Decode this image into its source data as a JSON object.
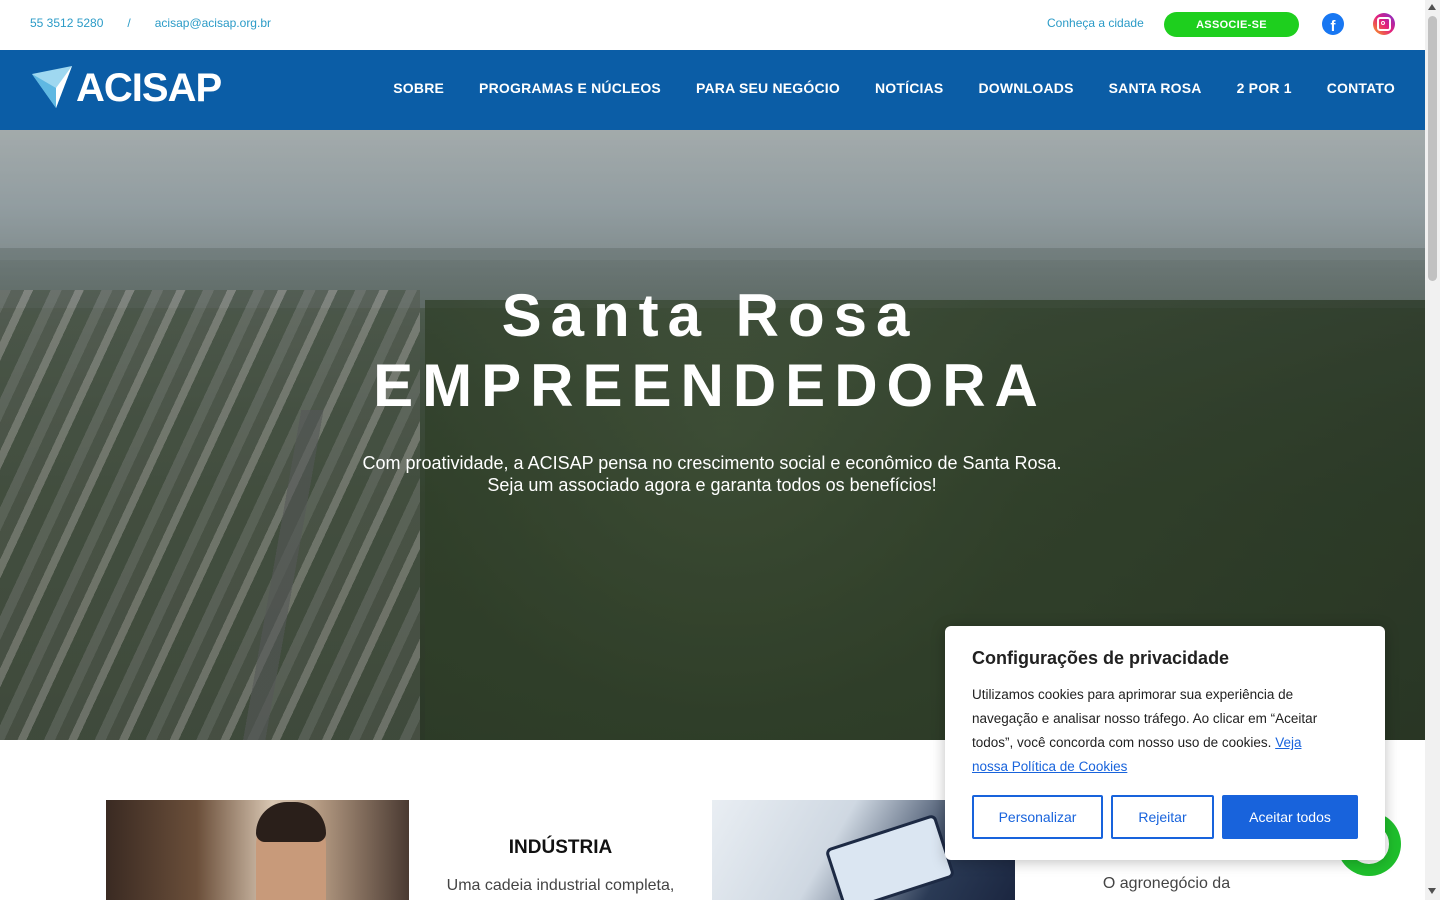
{
  "topbar": {
    "phone": "55 3512 5280",
    "separator": "/",
    "email": "acisap@acisap.org.br",
    "city_link": "Conheça a cidade",
    "associate_button": "ASSOCIE-SE",
    "facebook_glyph": "f"
  },
  "nav": {
    "logo_text": "ACISAP",
    "items": [
      "SOBRE",
      "PROGRAMAS E NÚCLEOS",
      "PARA SEU NEGÓCIO",
      "NOTÍCIAS",
      "DOWNLOADS",
      "SANTA ROSA",
      "2 POR 1",
      "CONTATO"
    ]
  },
  "hero": {
    "title_line1": "Santa Rosa",
    "title_line2": "EMPREENDEDORA",
    "desc_line1": "Com proatividade, a ACISAP pensa no crescimento social e econômico de Santa Rosa.",
    "desc_line2": "Seja um associado agora e garanta todos os benefícios!"
  },
  "cards": {
    "industry_title": "INDÚSTRIA",
    "industry_text": "Uma cadeia industrial completa,",
    "agro_text": "O agronegócio da"
  },
  "cookie": {
    "title": "Configurações de privacidade",
    "text": "Utilizamos cookies para aprimorar sua experiência de navegação e analisar nosso tráfego. Ao clicar em “Aceitar todos”, você concorda com nosso uso de cookies.",
    "link": "Veja nossa Política de Cookies",
    "personalize": "Personalizar",
    "reject": "Rejeitar",
    "accept": "Aceitar todos"
  },
  "colors": {
    "nav_bg": "#0b5da6",
    "accent_green": "#1ecf1e",
    "link_blue": "#2b9bc7",
    "cookie_blue": "#1863dc"
  }
}
